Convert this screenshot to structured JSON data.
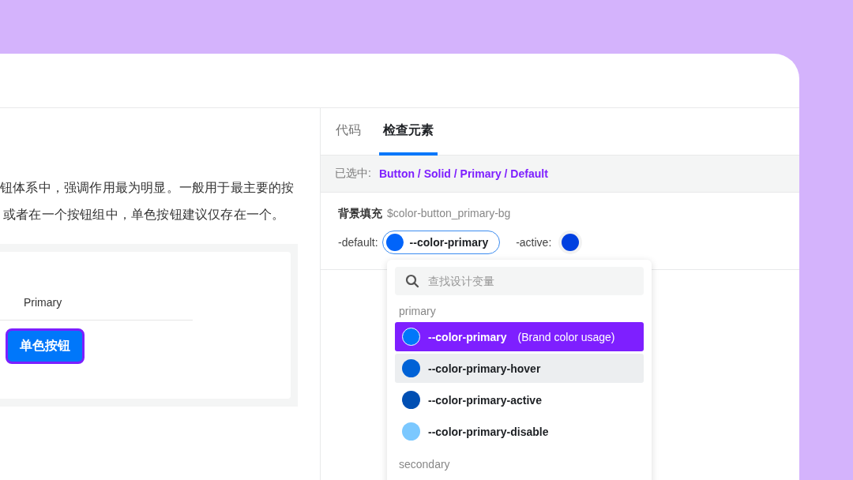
{
  "description": {
    "lines": [
      "钮体系中，强调作用最为明显。一般用于最主要的按",
      "或者在一个按钮组中，单色按钮建议仅存在一个。"
    ]
  },
  "demo": {
    "tab_label": "Primary",
    "button_label": "单色按钮"
  },
  "inspector": {
    "tabs": [
      {
        "label": "代码",
        "selected": false
      },
      {
        "label": "检查元素",
        "selected": true
      }
    ],
    "selection": {
      "label": "已选中:",
      "path": "Button / Solid / Primary / Default"
    },
    "property": {
      "name": "背景填充",
      "token": "$color-button_primary-bg"
    },
    "states": [
      {
        "label": "-default:",
        "value": "--color-primary",
        "color": "#0064fa",
        "open": true
      },
      {
        "label": "-active:",
        "color": "#0040e0",
        "open": false
      }
    ],
    "dropdown": {
      "search": {
        "placeholder": "查找设计变量"
      },
      "groups": [
        {
          "name": "primary",
          "items": [
            {
              "name": "--color-primary",
              "note": "(Brand color usage)",
              "color": "#0077fa",
              "selected": true,
              "hovered": false
            },
            {
              "name": "--color-primary-hover",
              "color": "#0062d6",
              "selected": false,
              "hovered": true
            },
            {
              "name": "--color-primary-active",
              "color": "#004fb3",
              "selected": false,
              "hovered": false
            },
            {
              "name": "--color-primary-disable",
              "color": "#7bc8ff",
              "selected": false,
              "hovered": false
            }
          ]
        },
        {
          "name": "secondary"
        }
      ]
    }
  }
}
